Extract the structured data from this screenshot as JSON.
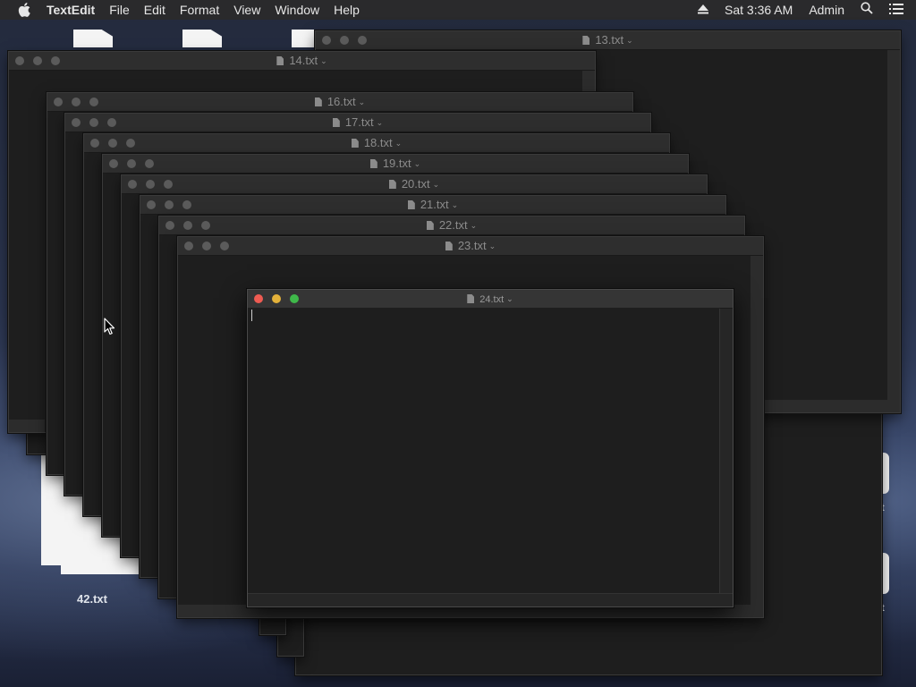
{
  "menubar": {
    "items": [
      "TextEdit",
      "File",
      "Edit",
      "Format",
      "View",
      "Window",
      "Help"
    ],
    "clock": "Sat 3:36 AM",
    "user": "Admin",
    "icons": [
      "apple-icon",
      "eject-icon",
      "spotlight-icon",
      "notification-center-icon"
    ]
  },
  "windows": {
    "w13": {
      "title": "13.txt"
    },
    "w14": {
      "title": "14.txt"
    },
    "w16": {
      "title": "16.txt"
    },
    "w17": {
      "title": "17.txt"
    },
    "w18": {
      "title": "18.txt"
    },
    "w19": {
      "title": "19.txt"
    },
    "w20": {
      "title": "20.txt"
    },
    "w21": {
      "title": "21.txt"
    },
    "w22": {
      "title": "22.txt"
    },
    "w23": {
      "title": "23.txt"
    },
    "w24": {
      "title": "24.txt",
      "active": true
    }
  },
  "desktop": {
    "icons": [
      {
        "label": "42.txt"
      },
      {
        "label": "t"
      },
      {
        "label": "t"
      }
    ]
  }
}
